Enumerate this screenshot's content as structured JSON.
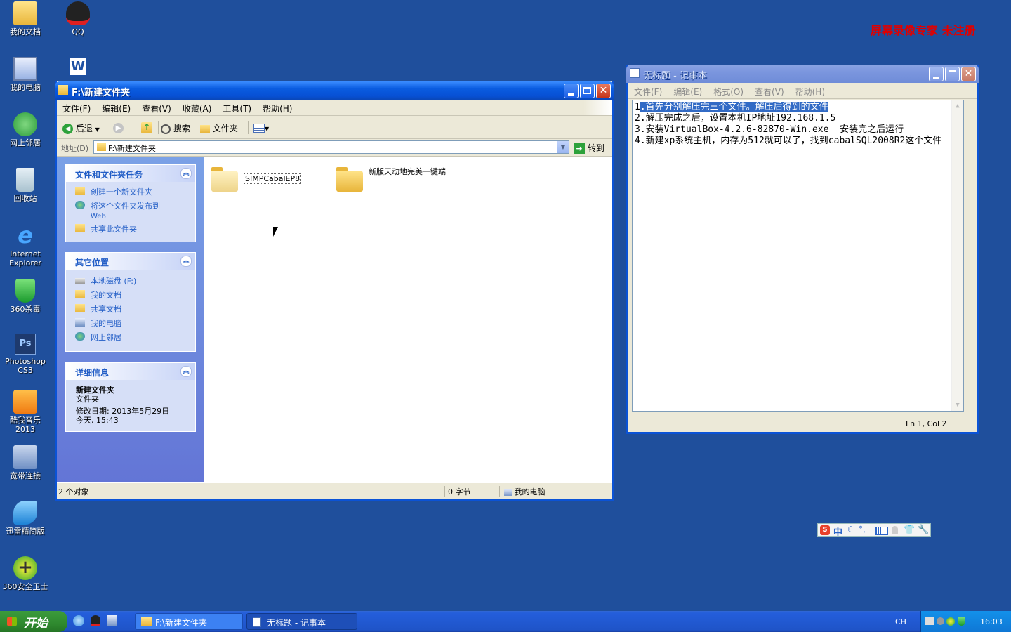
{
  "desktop": {
    "icons": [
      {
        "label": "我的文档",
        "icon": "my-documents-icon"
      },
      {
        "label": "QQ",
        "icon": "qq-icon"
      },
      {
        "label": "我的电脑",
        "icon": "my-computer-icon"
      },
      {
        "label": "网上邻居",
        "icon": "network-places-icon"
      },
      {
        "label": "回收站",
        "icon": "recycle-bin-icon"
      },
      {
        "label": "Internet Explorer",
        "icon": "ie-icon"
      },
      {
        "label": "360杀毒",
        "icon": "360-antivirus-icon"
      },
      {
        "label": "Photoshop CS3",
        "icon": "photoshop-icon"
      },
      {
        "label": "酷我音乐 2013",
        "icon": "kuwo-music-icon"
      },
      {
        "label": "宽带连接",
        "icon": "broadband-icon"
      },
      {
        "label": "迅雷精简版",
        "icon": "xunlei-icon"
      },
      {
        "label": "360安全卫士",
        "icon": "360-safe-icon"
      }
    ],
    "watermark": "屏幕录像专家 未注册"
  },
  "explorer": {
    "title": "F:\\新建文件夹",
    "menu": [
      "文件(F)",
      "编辑(E)",
      "查看(V)",
      "收藏(A)",
      "工具(T)",
      "帮助(H)"
    ],
    "toolbar": {
      "back": "后退",
      "search": "搜索",
      "folders": "文件夹"
    },
    "address": {
      "label": "地址(D)",
      "value": "F:\\新建文件夹",
      "go": "转到"
    },
    "panels": {
      "tasks": {
        "title": "文件和文件夹任务",
        "items": [
          "创建一个新文件夹",
          "将这个文件夹发布到",
          "Web",
          "共享此文件夹"
        ]
      },
      "places": {
        "title": "其它位置",
        "items": [
          "本地磁盘 (F:)",
          "我的文档",
          "共享文档",
          "我的电脑",
          "网上邻居"
        ]
      },
      "details": {
        "title": "详细信息",
        "name": "新建文件夹",
        "type": "文件夹",
        "modified": "修改日期: 2013年5月29日",
        "time": "今天, 15:43"
      }
    },
    "files": [
      {
        "name": "SIMPCabalEP8"
      },
      {
        "name": "新版天动地完美一键端"
      }
    ],
    "status": {
      "objects": "2 个对象",
      "size": "0 字节",
      "location": "我的电脑"
    }
  },
  "notepad": {
    "title": "无标题 - 记事本",
    "menu": [
      "文件(F)",
      "编辑(E)",
      "格式(O)",
      "查看(V)",
      "帮助(H)"
    ],
    "lines": {
      "l1_num": "1",
      "l1_sel": ".首先分别解压完三个文件。解压后得到的文件",
      "l2": "2.解压完成之后，设置本机IP地址192.168.1.5",
      "l3": "3.安装VirtualBox-4.2.6-82870-Win.exe  安装完之后运行",
      "l4": "4.新建xp系统主机，内存为512就可以了，找到cabalSQL2008R2这个文件"
    },
    "status": "Ln 1, Col 2"
  },
  "taskbar": {
    "start": "开始",
    "tasks": [
      "F:\\新建文件夹",
      "无标题 - 记事本"
    ],
    "lang": "CH",
    "clock": "16:03"
  },
  "colors": {
    "desktop": "#1f4f9c",
    "title_blue": "#0a5ce0",
    "selection": "#316ac5",
    "watermark": "#e00000"
  }
}
